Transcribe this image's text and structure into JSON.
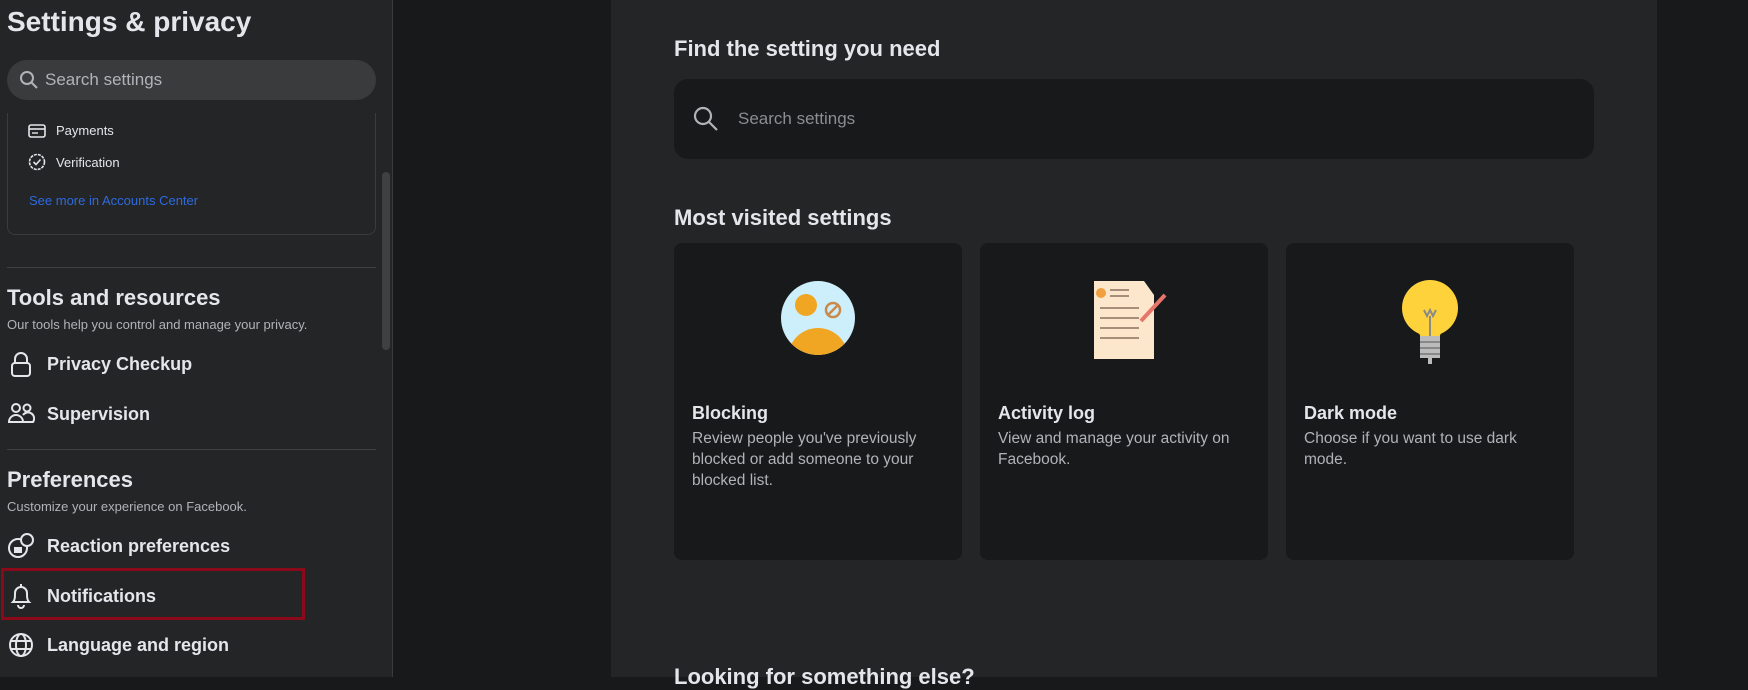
{
  "sidebar": {
    "title": "Settings & privacy",
    "search_placeholder": "Search settings",
    "accounts_items": [
      {
        "label": "Payments",
        "icon": "card-icon"
      },
      {
        "label": "Verification",
        "icon": "verified-badge-icon"
      }
    ],
    "accounts_link": "See more in Accounts Center",
    "tools": {
      "heading": "Tools and resources",
      "subtitle": "Our tools help you control and manage your privacy.",
      "items": [
        {
          "label": "Privacy Checkup",
          "icon": "lock-icon"
        },
        {
          "label": "Supervision",
          "icon": "people-icon"
        }
      ]
    },
    "preferences": {
      "heading": "Preferences",
      "subtitle": "Customize your experience on Facebook.",
      "items": [
        {
          "label": "Reaction preferences",
          "icon": "reaction-icon"
        },
        {
          "label": "Notifications",
          "icon": "bell-icon"
        },
        {
          "label": "Language and region",
          "icon": "globe-icon"
        }
      ]
    }
  },
  "main": {
    "find_heading": "Find the setting you need",
    "search_placeholder": "Search settings",
    "most_visited_heading": "Most visited settings",
    "cards": [
      {
        "title": "Blocking",
        "desc": "Review people you've previously blocked or add someone to your blocked list."
      },
      {
        "title": "Activity log",
        "desc": "View and manage your activity on Facebook."
      },
      {
        "title": "Dark mode",
        "desc": "Choose if you want to use dark mode."
      }
    ],
    "looking_heading": "Looking for something else?"
  },
  "colors": {
    "highlight": "#8b0a1a",
    "link": "#2d6ae0"
  }
}
